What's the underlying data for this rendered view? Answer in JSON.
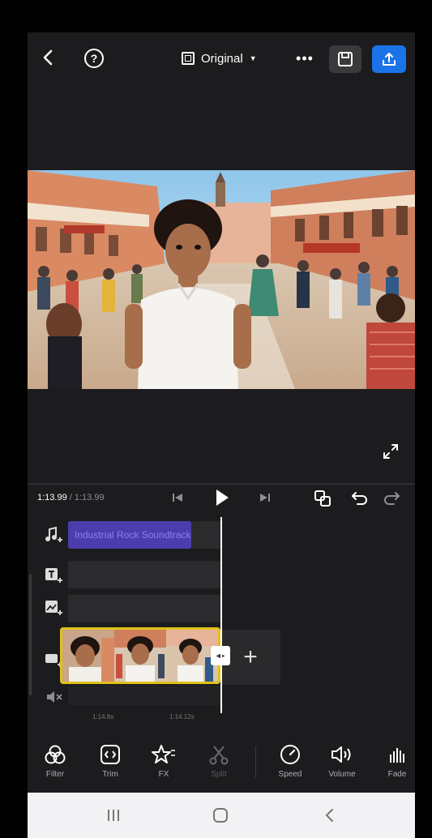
{
  "topbar": {
    "aspect_label": "Original",
    "icons": [
      "back-icon",
      "help-icon",
      "aspect-ratio-icon",
      "more-icon",
      "save-icon",
      "export-icon"
    ]
  },
  "player": {
    "current_time": "1:13.99",
    "separator": " / ",
    "total_time": "1:13.99"
  },
  "timeline": {
    "audio_clip_label": "Industrial Rock Soundtrack",
    "ruler_ticks": [
      "1:14.8s",
      "1:14.12s"
    ]
  },
  "tools": [
    {
      "label": "Filter",
      "icon": "filter-icon",
      "enabled": true
    },
    {
      "label": "Trim",
      "icon": "trim-icon",
      "enabled": true
    },
    {
      "label": "FX",
      "icon": "fx-icon",
      "enabled": true
    },
    {
      "label": "Split",
      "icon": "split-icon",
      "enabled": false
    },
    {
      "label": "Speed",
      "icon": "speed-icon",
      "enabled": true
    },
    {
      "label": "Volume",
      "icon": "volume-icon",
      "enabled": true
    },
    {
      "label": "Fade",
      "icon": "fade-icon",
      "enabled": true
    }
  ],
  "colors": {
    "accent_blue": "#1a73e8",
    "clip_border": "#e0c21a",
    "audio_clip": "#4b3dae",
    "background": "#1c1c1e"
  }
}
